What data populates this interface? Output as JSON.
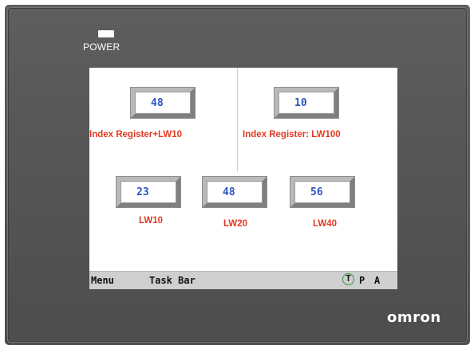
{
  "device": {
    "power_label": "POWER",
    "brand": "omron",
    "colors": {
      "bezel": "#565656",
      "led": "#ffffff",
      "value_text": "#2a55c4",
      "label_text": "#e23a22",
      "taskbar": "#cfcfcf",
      "active_indicator": "#2d9b3a"
    }
  },
  "screen": {
    "top_row": [
      {
        "value": "48",
        "label": "Index Register+LW10"
      },
      {
        "value": "10",
        "label": "Index Register: LW100"
      }
    ],
    "bottom_row": [
      {
        "value": "23",
        "label": "LW10"
      },
      {
        "value": "48",
        "label": "LW20"
      },
      {
        "value": "56",
        "label": "LW40"
      }
    ]
  },
  "taskbar": {
    "menu_label": "Menu",
    "taskbar_label": "Task Bar",
    "indicator_t": "T",
    "indicator_p": "P",
    "indicator_a": "A",
    "active_indicator": "T"
  }
}
